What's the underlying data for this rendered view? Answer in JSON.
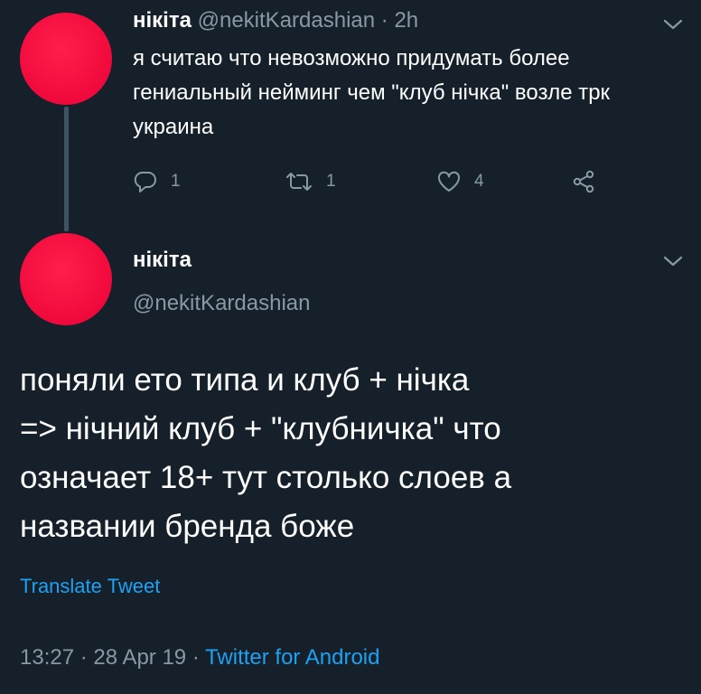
{
  "colors": {
    "background": "#15202b",
    "text": "#ffffff",
    "muted": "#8899a6",
    "link": "#1da1f2",
    "avatar": "#f0093c"
  },
  "parent_tweet": {
    "name": "нікіта",
    "handle": "@nekitKardashian",
    "separator": "·",
    "time": "2h",
    "text": "я считаю что невозможно придумать более гениальный нейминг чем \"клуб нічка\" возле трк украина",
    "actions": {
      "reply": {
        "icon": "reply-icon",
        "count": "1"
      },
      "retweet": {
        "icon": "retweet-icon",
        "count": "1"
      },
      "like": {
        "icon": "heart-icon",
        "count": "4"
      },
      "share": {
        "icon": "share-icon"
      }
    }
  },
  "main_tweet": {
    "name": "нікіта",
    "handle": "@nekitKardashian",
    "text": "поняли ето типа и клуб + нічка\n=>  нічний клуб +  \"клубничка\" что\nозначает 18+ тут столько слоев а\nназвании бренда боже",
    "translate_label": "Translate Tweet",
    "time": "13:27",
    "date": "28 Apr 19",
    "separator": "·",
    "source": "Twitter for Android"
  }
}
